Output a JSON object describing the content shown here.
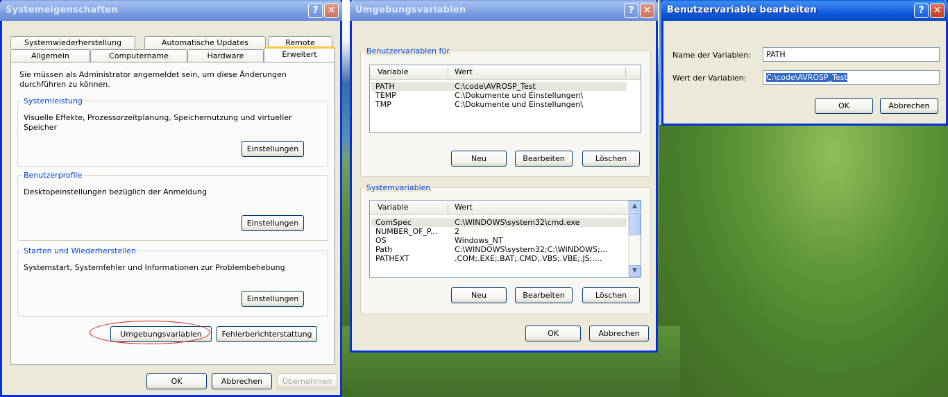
{
  "sysprops": {
    "title": "Systemeigenschaften",
    "tabs_row1": [
      "Systemwiederherstellung",
      "Automatische Updates",
      "Remote"
    ],
    "tabs_row2": [
      "Allgemein",
      "Computername",
      "Hardware",
      "Erweitert"
    ],
    "admin_note": "Sie müssen als Administrator angemeldet sein, um diese Änderungen durchführen zu können.",
    "perf": {
      "legend": "Systemleistung",
      "text": "Visuelle Effekte, Prozessorzeitplanung, Speichernutzung und virtueller Speicher",
      "button": "Einstellungen"
    },
    "profiles": {
      "legend": "Benutzerprofile",
      "text": "Desktopeinstellungen bezüglich der Anmeldung",
      "button": "Einstellungen"
    },
    "startup": {
      "legend": "Starten und Wiederherstellen",
      "text": "Systemstart, Systemfehler und Informationen zur Problembehebung",
      "button": "Einstellungen"
    },
    "env_button": "Umgebungsvariablen",
    "error_button": "Fehlerberichterstattung",
    "ok": "OK",
    "cancel": "Abbrechen",
    "apply": "Übernehmen"
  },
  "envvars": {
    "title": "Umgebungsvariablen",
    "user_legend": "Benutzervariablen für",
    "col_variable": "Variable",
    "col_value": "Wert",
    "user_rows": [
      {
        "var": "PATH",
        "val": "C:\\code\\AVROSP_Test"
      },
      {
        "var": "TEMP",
        "val": "C:\\Dokumente und Einstellungen\\"
      },
      {
        "var": "TMP",
        "val": "C:\\Dokumente und Einstellungen\\"
      }
    ],
    "system_legend": "Systemvariablen",
    "system_rows": [
      {
        "var": "ComSpec",
        "val": "C:\\WINDOWS\\system32\\cmd.exe"
      },
      {
        "var": "NUMBER_OF_P...",
        "val": "2"
      },
      {
        "var": "OS",
        "val": "Windows_NT"
      },
      {
        "var": "Path",
        "val": "C:\\WINDOWS\\system32;C:\\WINDOWS;..."
      },
      {
        "var": "PATHEXT",
        "val": ".COM;.EXE;.BAT;.CMD;.VBS;.VBE;.JS;...."
      }
    ],
    "new": "Neu",
    "edit": "Bearbeiten",
    "delete": "Löschen",
    "ok": "OK",
    "cancel": "Abbrechen"
  },
  "editvar": {
    "title": "Benutzervariable bearbeiten",
    "name_label": "Name der Variablen:",
    "name_value": "PATH",
    "value_label": "Wert der Variablen:",
    "value_value": "C:\\code\\AVROSP_Test",
    "ok": "OK",
    "cancel": "Abbrechen"
  },
  "titlebar_buttons": {
    "help": "?",
    "close": "✕"
  }
}
